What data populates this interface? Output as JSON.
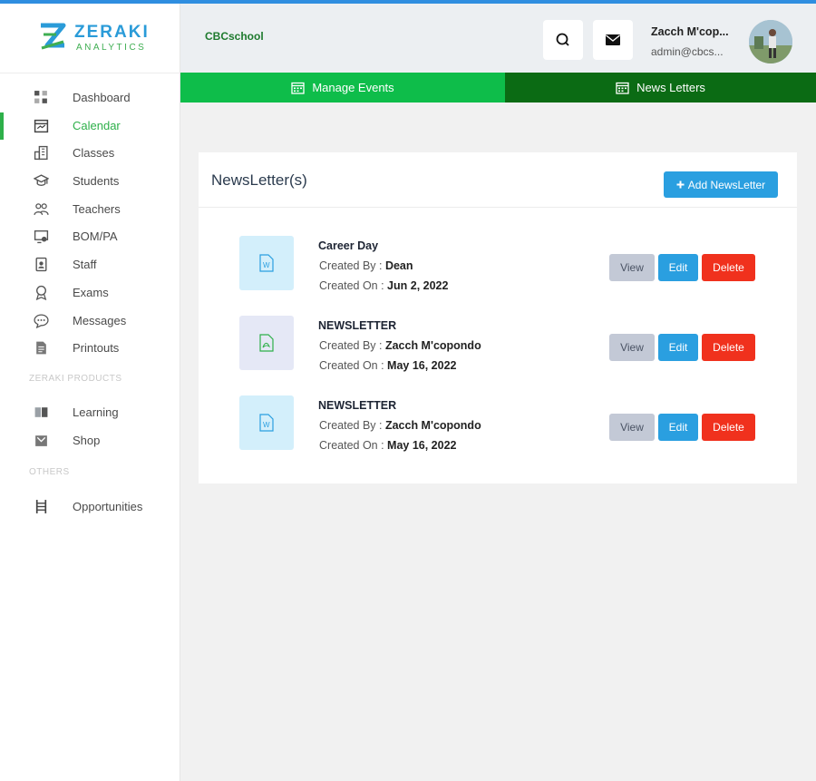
{
  "brand": {
    "name": "ZERAKI",
    "sub": "ANALYTICS"
  },
  "sidebar": {
    "items": [
      {
        "label": "Dashboard",
        "icon": "dashboard-icon"
      },
      {
        "label": "Calendar",
        "icon": "calendar-icon"
      },
      {
        "label": "Classes",
        "icon": "building-icon"
      },
      {
        "label": "Students",
        "icon": "graduation-cap-icon"
      },
      {
        "label": "Teachers",
        "icon": "people-icon"
      },
      {
        "label": "BOM/PA",
        "icon": "monitor-user-icon"
      },
      {
        "label": "Staff",
        "icon": "id-badge-icon"
      },
      {
        "label": "Exams",
        "icon": "award-icon"
      },
      {
        "label": "Messages",
        "icon": "chat-icon"
      },
      {
        "label": "Printouts",
        "icon": "document-icon"
      }
    ],
    "products_heading": "ZERAKI PRODUCTS",
    "products": [
      {
        "label": "Learning",
        "icon": "book-icon"
      },
      {
        "label": "Shop",
        "icon": "shop-icon"
      }
    ],
    "others_heading": "OTHERS",
    "others": [
      {
        "label": "Opportunities",
        "icon": "ladder-icon"
      }
    ]
  },
  "header": {
    "school": "CBCschool",
    "user_name": "Zacch M'cop...",
    "user_email": "admin@cbcs...",
    "icons": [
      "search-icon",
      "mail-icon"
    ]
  },
  "tabs": [
    {
      "label": "Manage Events",
      "icon": "calendar-grid-icon"
    },
    {
      "label": "News Letters",
      "icon": "calendar-grid-icon"
    }
  ],
  "panel": {
    "title": "NewsLetter(s)",
    "add_button": "Add NewsLetter"
  },
  "labels": {
    "created_by": "Created By : ",
    "created_on": "Created On : "
  },
  "newsletters": [
    {
      "title": "Career Day",
      "created_by": "Dean",
      "created_on": "Jun 2, 2022",
      "file_type": "word-file-icon"
    },
    {
      "title": "NEWSLETTER",
      "created_by": "Zacch M'copondo",
      "created_on": "May 16, 2022",
      "file_type": "pdf-file-icon"
    },
    {
      "title": "NEWSLETTER",
      "created_by": "Zacch M'copondo",
      "created_on": "May 16, 2022",
      "file_type": "word-file-icon"
    }
  ],
  "actions": {
    "view": "View",
    "edit": "Edit",
    "delete": "Delete"
  },
  "colors": {
    "primary_green": "#0ebd4a",
    "dark_green": "#0b6b14",
    "blue": "#2a9fe0",
    "red": "#f0311d"
  }
}
